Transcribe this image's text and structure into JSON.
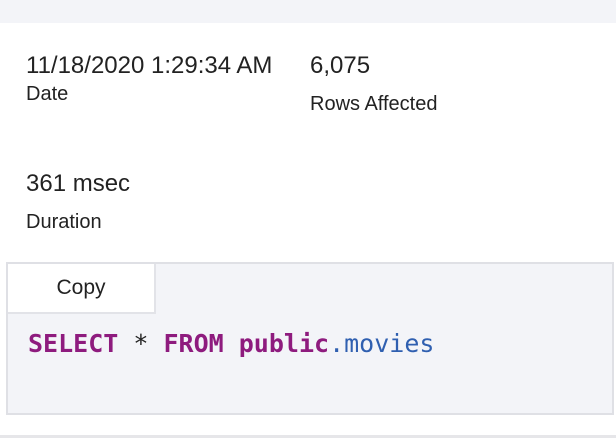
{
  "stats": {
    "date_value": "11/18/2020 1:29:34 AM",
    "date_label": "Date",
    "duration_value": "361 msec",
    "duration_label": "Duration",
    "rows_value": "6,075",
    "rows_label": "Rows Affected"
  },
  "code": {
    "copy_label": "Copy",
    "tokens": {
      "select": "SELECT",
      "star": " * ",
      "from": "FROM",
      "space": " ",
      "schema": "public",
      "dot": ".",
      "table": "movies"
    }
  },
  "colors": {
    "keyword": "#8e1b7e",
    "identifier": "#2f5fb0",
    "panel_bg": "#f3f4f8"
  }
}
